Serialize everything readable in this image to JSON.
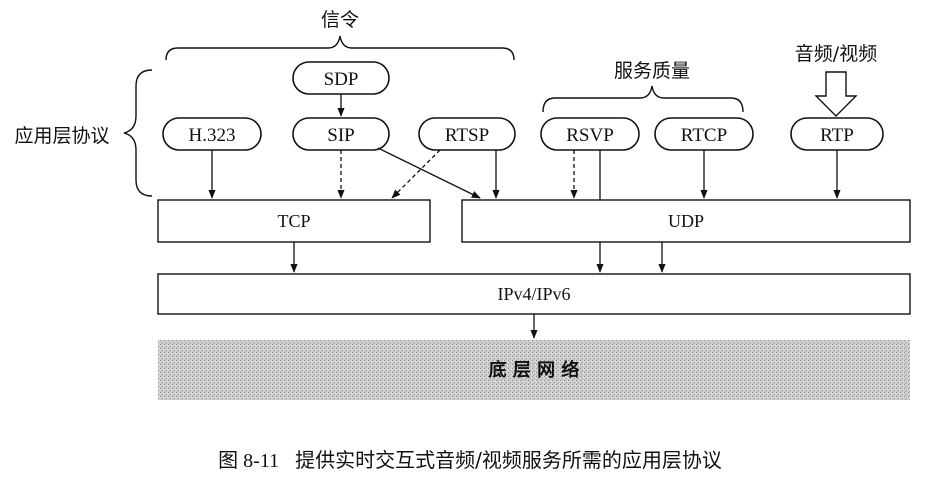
{
  "labels": {
    "signaling": "信令",
    "qos": "服务质量",
    "media": "音频/视频",
    "app_layer": "应用层协议"
  },
  "protocols": {
    "sdp": "SDP",
    "h323": "H.323",
    "sip": "SIP",
    "rtsp": "RTSP",
    "rsvp": "RSVP",
    "rtcp": "RTCP",
    "rtp": "RTP"
  },
  "layers": {
    "tcp": "TCP",
    "udp": "UDP",
    "ip": "IPv4/IPv6",
    "network": "底 层 网 络"
  },
  "caption": {
    "number": "图 8-11",
    "text": "提供实时交互式音频/视频服务所需的应用层协议"
  }
}
